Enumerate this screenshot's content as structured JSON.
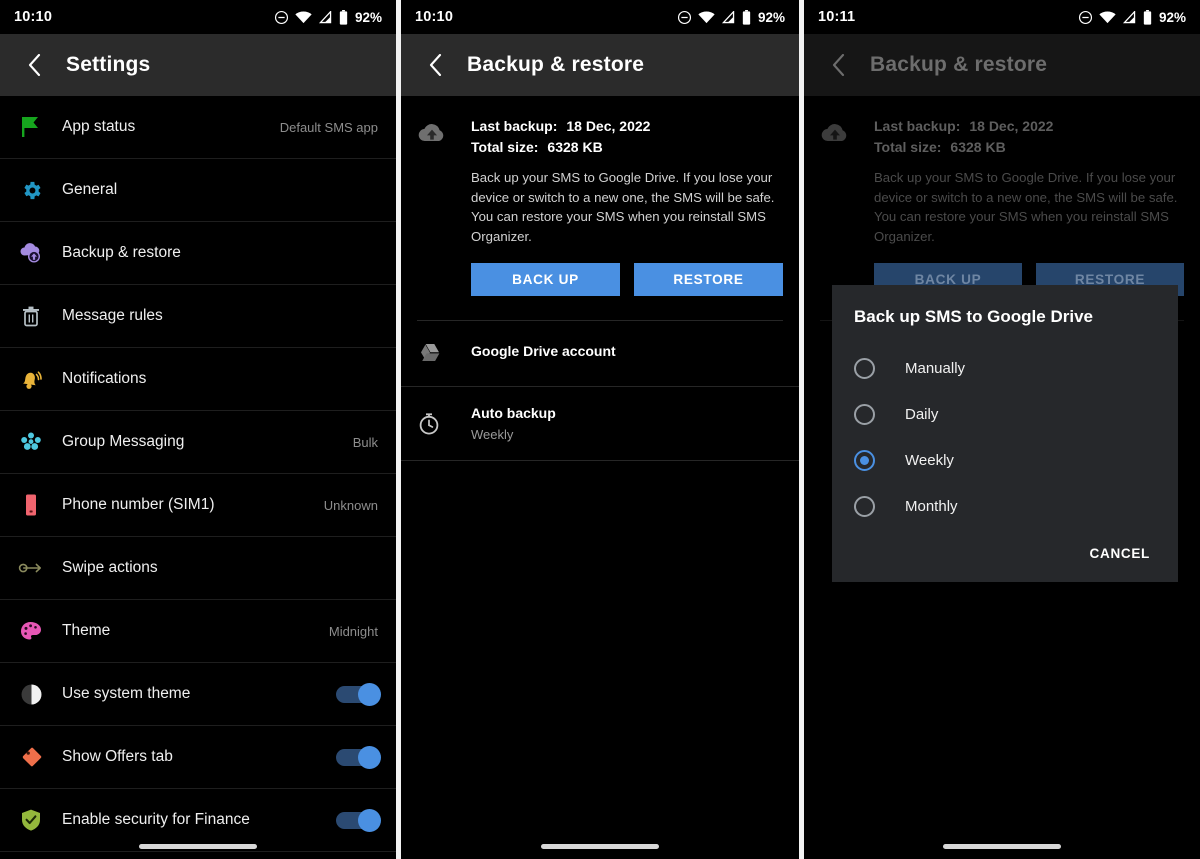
{
  "panels": {
    "settings": {
      "status": {
        "time": "10:10",
        "battery": "92%",
        "icons": [
          "dnd-icon",
          "wifi-icon",
          "signal-icon",
          "battery-icon"
        ]
      },
      "appbar": {
        "title": "Settings",
        "back": "back-arrow-icon"
      },
      "items": [
        {
          "label": "App status",
          "value": "Default SMS app",
          "icon": "flag-icon",
          "type": "value"
        },
        {
          "label": "General",
          "value": "",
          "icon": "gear-icon",
          "type": "plain"
        },
        {
          "label": "Backup & restore",
          "value": "",
          "icon": "cloud-upload-icon",
          "type": "plain"
        },
        {
          "label": "Message rules",
          "value": "",
          "icon": "trash-icon",
          "type": "plain"
        },
        {
          "label": "Notifications",
          "value": "",
          "icon": "bell-icon",
          "type": "plain"
        },
        {
          "label": "Group Messaging",
          "value": "Bulk",
          "icon": "group-icon",
          "type": "value"
        },
        {
          "label": "Phone number (SIM1)",
          "value": "Unknown",
          "icon": "sim-card-icon",
          "type": "value"
        },
        {
          "label": "Swipe actions",
          "value": "",
          "icon": "swipe-arrow-icon",
          "type": "plain"
        },
        {
          "label": "Theme",
          "value": "Midnight",
          "icon": "palette-icon",
          "type": "value"
        },
        {
          "label": "Use system theme",
          "value": "on",
          "icon": "contrast-icon",
          "type": "toggle"
        },
        {
          "label": "Show Offers tab",
          "value": "on",
          "icon": "tag-icon",
          "type": "toggle"
        },
        {
          "label": "Enable security for Finance",
          "value": "on",
          "icon": "shield-check-icon",
          "type": "toggle"
        }
      ]
    },
    "backup": {
      "status": {
        "time": "10:10",
        "battery": "92%"
      },
      "appbar": {
        "title": "Backup & restore",
        "back": "back-arrow-icon"
      },
      "last_backup_label": "Last backup:",
      "last_backup_value": "18 Dec, 2022",
      "total_size_label": "Total size:",
      "total_size_value": "6328 KB",
      "description": "Back up your SMS to Google Drive. If you lose your device or switch to a new one, the SMS will be safe. You can restore your SMS when you reinstall SMS Organizer.",
      "backup_button": "BACK UP",
      "restore_button": "RESTORE",
      "rows": [
        {
          "title": "Google Drive account",
          "subtitle": "",
          "icon": "google-drive-icon"
        },
        {
          "title": "Auto backup",
          "subtitle": "Weekly",
          "icon": "stopwatch-icon"
        }
      ]
    },
    "dialog_screen": {
      "status": {
        "time": "10:11",
        "battery": "92%"
      },
      "appbar": {
        "title": "Backup & restore",
        "back": "back-arrow-icon"
      },
      "dialog": {
        "title": "Back up SMS to Google Drive",
        "options": [
          {
            "label": "Manually",
            "selected": false
          },
          {
            "label": "Daily",
            "selected": false
          },
          {
            "label": "Weekly",
            "selected": true
          },
          {
            "label": "Monthly",
            "selected": false
          }
        ],
        "cancel": "CANCEL"
      }
    }
  },
  "colors": {
    "accent_blue": "#4a90e2",
    "appbar": "#2b2b2b",
    "dialog_bg": "#26282b",
    "background": "#000000"
  }
}
